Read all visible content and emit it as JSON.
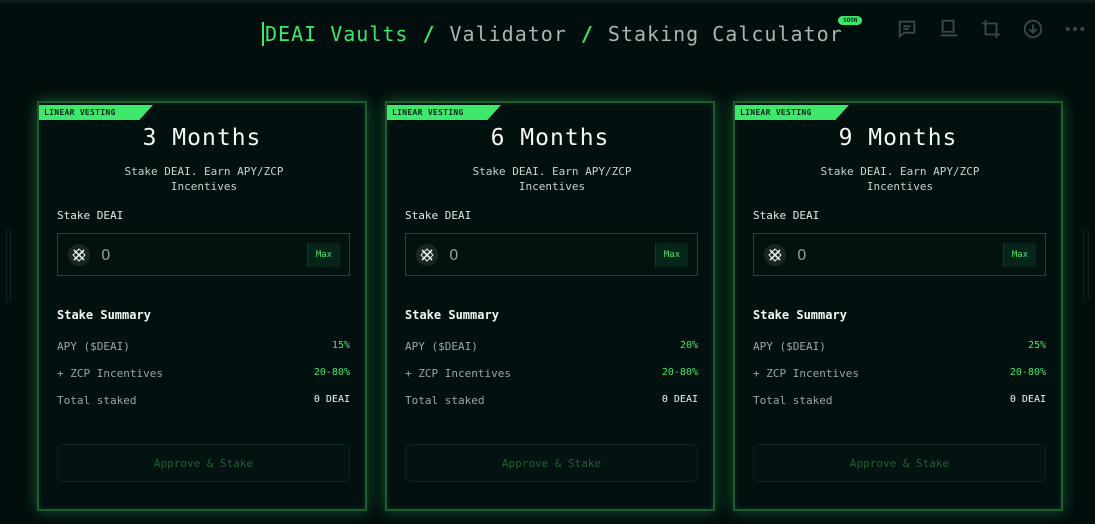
{
  "header": {
    "crumbs": [
      "DEAI Vaults",
      "Validator",
      "Staking Calculator"
    ],
    "separator": "/",
    "badge": "SOON"
  },
  "toolbar": {
    "icons": [
      "comment-icon",
      "layout-icon",
      "crop-icon",
      "download-icon",
      "more-icon"
    ]
  },
  "colors": {
    "accent": "#3ee86b",
    "background": "#020d0d",
    "card_border": "#1f5a2c"
  },
  "cards": [
    {
      "tag": "LINEAR VESTING",
      "title": "3 Months",
      "description": "Stake DEAI. Earn APY/ZCP Incentives",
      "stake_label": "Stake DEAI",
      "amount": "0",
      "max_label": "Max",
      "summary_title": "Stake Summary",
      "apy_label": "APY ($DEAI)",
      "apy_value": "15%",
      "zcp_label": "+ ZCP Incentives",
      "zcp_value": "20-80%",
      "total_label": "Total staked",
      "total_value": "0 DEAI",
      "button_label": "Approve & Stake"
    },
    {
      "tag": "LINEAR VESTING",
      "title": "6 Months",
      "description": "Stake DEAI. Earn APY/ZCP Incentives",
      "stake_label": "Stake DEAI",
      "amount": "0",
      "max_label": "Max",
      "summary_title": "Stake Summary",
      "apy_label": "APY ($DEAI)",
      "apy_value": "20%",
      "zcp_label": "+ ZCP Incentives",
      "zcp_value": "20-80%",
      "total_label": "Total staked",
      "total_value": "0 DEAI",
      "button_label": "Approve & Stake"
    },
    {
      "tag": "LINEAR VESTING",
      "title": "9 Months",
      "description": "Stake DEAI. Earn APY/ZCP Incentives",
      "stake_label": "Stake DEAI",
      "amount": "0",
      "max_label": "Max",
      "summary_title": "Stake Summary",
      "apy_label": "APY ($DEAI)",
      "apy_value": "25%",
      "zcp_label": "+ ZCP Incentives",
      "zcp_value": "20-80%",
      "total_label": "Total staked",
      "total_value": "0 DEAI",
      "button_label": "Approve & Stake"
    }
  ]
}
